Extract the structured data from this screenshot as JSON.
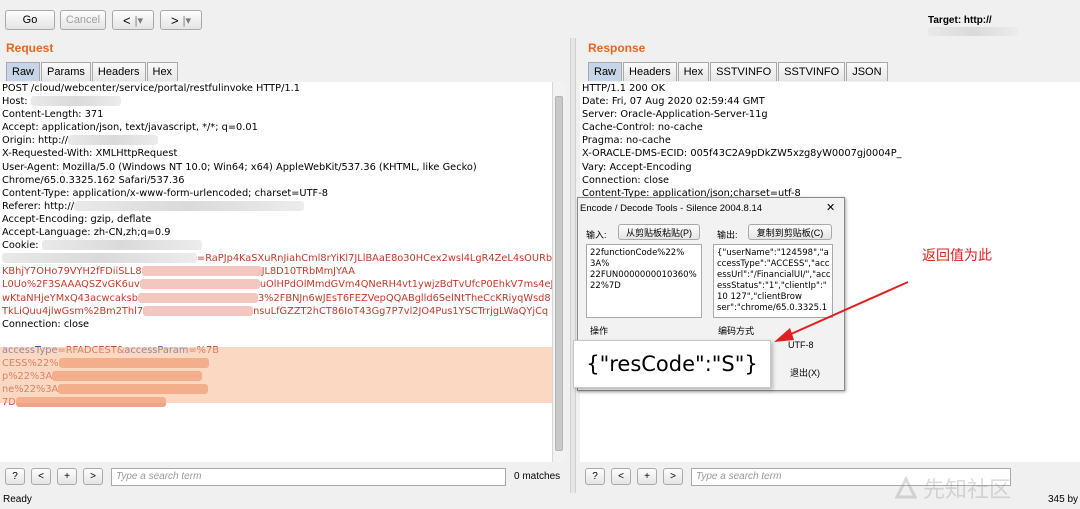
{
  "toolbar": {
    "go_label": "Go",
    "cancel_label": "Cancel",
    "back_label": "<",
    "back_menu_label": "|▾",
    "forward_label": ">",
    "forward_menu_label": "|▾",
    "target_label": "Target: http://"
  },
  "request": {
    "title": "Request",
    "tabs": [
      "Raw",
      "Params",
      "Headers",
      "Hex"
    ],
    "lines": [
      {
        "t": "POST /cloud/webcenter/service/portal/restfulinvoke HTTP/1.1"
      },
      {
        "t": "Host: "
      },
      {
        "t": "Content-Length: 371"
      },
      {
        "t": "Accept: application/json, text/javascript, */*; q=0.01"
      },
      {
        "t": "Origin: http://"
      },
      {
        "t": "X-Requested-With: XMLHttpRequest"
      },
      {
        "t": "User-Agent: Mozilla/5.0 (Windows NT 10.0; Win64; x64) AppleWebKit/537.36 (KHTML, like Gecko)"
      },
      {
        "t": "Chrome/65.0.3325.162 Safari/537.36"
      },
      {
        "t": "Content-Type: application/x-www-form-urlencoded; charset=UTF-8"
      },
      {
        "t": "Referer: http://"
      },
      {
        "t": "Accept-Encoding: gzip, deflate"
      },
      {
        "t": "Accept-Language: zh-CN,zh;q=0.9"
      },
      {
        "t": "Cookie: "
      },
      {
        "t": "=RaPJp4KaSXuRnJiahCml8rYiKl7JLlBAaE8o30HCex2wsl4LgR4ZeL4sOURbK"
      },
      {
        "t": "KBhjY7OHo79VYH2fFDiiSLL8"
      },
      {
        "t": "L0Uo%2F3SAAAQSZvGK6uv"
      },
      {
        "t": "wKtaNHjeYMxQ43acwcaksb"
      },
      {
        "t": "TkLiQuu4jlwGsm%2Bm2Thl7"
      },
      {
        "t": "Connection: close"
      },
      {
        "t": ""
      },
      {
        "t": "accessType=RFADCEST&accessParam=%7B"
      },
      {
        "t": "CESS%22%"
      },
      {
        "t": "p%22%3A"
      },
      {
        "t": "ne%22%3A"
      },
      {
        "t": "7D"
      }
    ],
    "cookie_tail": [
      "JL8D10TRbMmJYAA",
      "uOlHPdOlMmdGVm4QNeRH4vt1ywjzBdTvUfcP0EhkV7ms4eJ",
      "3%2FBNJn6wJEsT6FEZVepQQABglld6SelNtTheCcKRiyqWsd8",
      "nsuLfGZZT2hCT86IoT43Gg7P7vl2JO4Pus1YSCTrrjgLWaQYjCq"
    ],
    "search_placeholder": "Type a search term",
    "matches": "0 matches"
  },
  "response": {
    "title": "Response",
    "tabs": [
      "Raw",
      "Headers",
      "Hex",
      "SSTVINFO",
      "SSTVINFO",
      "JSON"
    ],
    "lines": [
      "HTTP/1.1 200 OK",
      "Date: Fri, 07 Aug 2020 02:59:44 GMT",
      "Server: Oracle-Application-Server-11g",
      "Cache-Control: no-cache",
      "Pragma: no-cache",
      "X-ORACLE-DMS-ECID: 005f43C2A9pDkZW5xzg8yW0007gj0004P_",
      "Vary: Accept-Encoding",
      "Connection: close",
      "Content-Type: application/json;charset=utf-8"
    ],
    "search_placeholder": "Type a search term",
    "size_label": "345 by"
  },
  "dialog": {
    "title": "Encode / Decode Tools - Silence 2004.8.14",
    "close_label": "✕",
    "input_label": "输入:",
    "paste_button": "从剪贴板粘贴(P)",
    "output_label": "输出:",
    "copy_button": "复制到剪贴板(C)",
    "input_lines": [
      "22functionCode%22%",
      "3A%",
      "22FUN0000000010360%",
      "22%7D"
    ],
    "output_lines": [
      "{\"userName\":\"124598\",\"a",
      "ccessType\":\"ACCESS\",\"acc",
      "essUrl\":\"/FinancialUI/\",\"acc",
      "essStatus\":\"1\",\"clientIp\":\"",
      "10          127\",\"clientBrow",
      "ser\":\"chrome/65.0.3325.1"
    ],
    "ops_label": "操作",
    "encoding_label": "编码方式",
    "encoding_value": "UTF-8",
    "exit_label": "退出(X)"
  },
  "callout": {
    "res_code_text": "{\"resCode\":\"S\"}",
    "annotation": "返回值为此"
  },
  "status": {
    "ready": "Ready"
  },
  "watermark": {
    "text": "先知社区"
  },
  "colors": {
    "accent": "#e8671c",
    "selection": "#f6b88f",
    "annotation": "#e02020"
  }
}
